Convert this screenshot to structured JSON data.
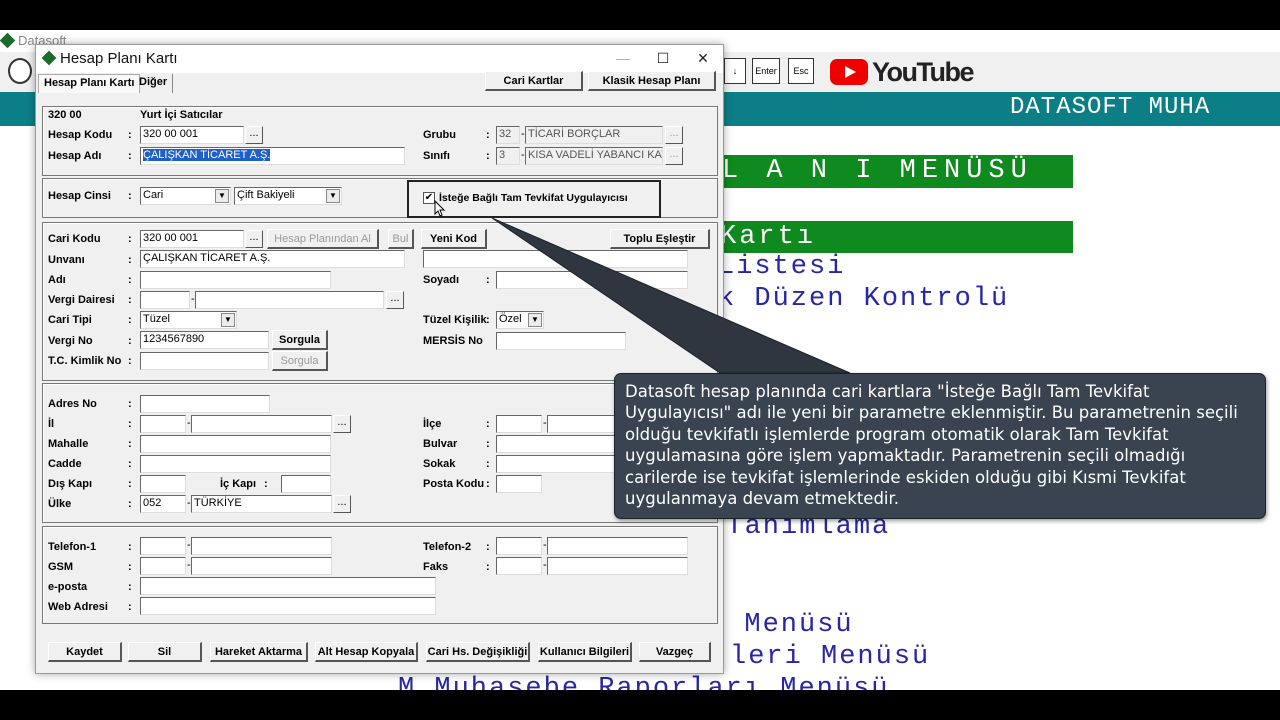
{
  "bg": {
    "title": "Datasoft",
    "toolbar_buttons": [
      "↓",
      "Enter",
      "Esc"
    ],
    "youtube_label": "YouTube",
    "band_text": "DATASOFT MUHA",
    "menu_header": "L A N I  MENÜSÜ",
    "menu_selected": "Kartı",
    "menu_items": [
      "Listesi",
      "k Düzen Kontrolü",
      "t Tanımlama",
      "i Menüsü",
      "leri Menüsü",
      "M  Muhasebe Raporları Menüsü"
    ]
  },
  "window": {
    "title": "Hesap Planı Kartı",
    "tabs": [
      "Hesap Planı Kartı",
      "Diğer"
    ],
    "top_buttons": {
      "cari_kartlar": "Cari Kartlar",
      "klasik_hesap_plani": "Klasik Hesap Planı"
    }
  },
  "account": {
    "code_display": "320 00",
    "name_display": "Yurt İçi Satıcılar",
    "hesap_kodu_label": "Hesap Kodu",
    "hesap_kodu": "320 00 001",
    "hesap_adi_label": "Hesap Adı",
    "hesap_adi": "ÇALIŞKAN TİCARET A.Ş.",
    "grubu_label": "Grubu",
    "grubu_code": "32",
    "grubu_name": "TİCARİ BORÇLAR",
    "sinifi_label": "Sınıfı",
    "sinifi_code": "3",
    "sinifi_name": "KISA VADELİ YABANCI KAYNAKLAR",
    "hesap_cinsi_label": "Hesap Cinsi",
    "hesap_cinsi": "Cari",
    "bakiye_tipi": "Çift Bakiyeli",
    "tevkifat_label": "İsteğe Bağlı Tam Tevkifat Uygulayıcısı"
  },
  "cari": {
    "cari_kodu_label": "Cari Kodu",
    "cari_kodu": "320 00 001",
    "hesap_planindan_al": "Hesap Planından Al",
    "bul": "Bul",
    "yeni_kod": "Yeni Kod",
    "toplu_eslestir": "Toplu Eşleştir",
    "unvani_label": "Unvanı",
    "unvani": "ÇALIŞKAN TİCARET A.Ş.",
    "adi_label": "Adı",
    "soyadi_label": "Soyadı",
    "vergi_dairesi_label": "Vergi Dairesi",
    "cari_tipi_label": "Cari Tipi",
    "cari_tipi": "Tüzel",
    "tuzel_kisilik_label": "Tüzel Kişilik",
    "tuzel_kisilik": "Özel",
    "vergi_no_label": "Vergi No",
    "vergi_no": "1234567890",
    "sorgula": "Sorgula",
    "mersis_label": "MERSİS No",
    "tc_label": "T.C. Kimlik No"
  },
  "address": {
    "adres_no": "Adres No",
    "il": "İl",
    "ilce": "İlçe",
    "mahalle": "Mahalle",
    "bulvar": "Bulvar",
    "cadde": "Cadde",
    "sokak": "Sokak",
    "dis_kapi": "Dış Kapı",
    "ic_kapi": "İç Kapı",
    "posta_kodu": "Posta Kodu",
    "ulke": "Ülke",
    "ulke_code": "052",
    "ulke_name": "TÜRKİYE"
  },
  "contact": {
    "telefon1": "Telefon-1",
    "telefon2": "Telefon-2",
    "gsm": "GSM",
    "faks": "Faks",
    "eposta": "e-posta",
    "web": "Web Adresi"
  },
  "footer_buttons": [
    "Kaydet",
    "Sil",
    "Hareket Aktarma",
    "Alt Hesap Kopyala",
    "Cari Hs. Değişikliği",
    "Kullanıcı Bilgileri",
    "Vazgeç"
  ],
  "tooltip": "Datasoft hesap planında cari kartlara \"İsteğe Bağlı Tam Tevkifat Uygulayıcısı\" adı ile yeni bir parametre eklenmiştir. Bu parametrenin seçili olduğu tevkifatlı işlemlerde program otomatik olarak Tam Tevkifat uygulamasına göre işlem yapmaktadır. Parametrenin seçili olmadığı carilerde ise tevkifat işlemlerinde eskiden olduğu gibi Kısmi Tevkifat uygulanmaya devam etmektedir.",
  "colors": {
    "band": "#0c7f86",
    "green_bar": "#0e8a1e",
    "menu_text": "#2826a6",
    "tooltip_bg": "#3a4350"
  }
}
